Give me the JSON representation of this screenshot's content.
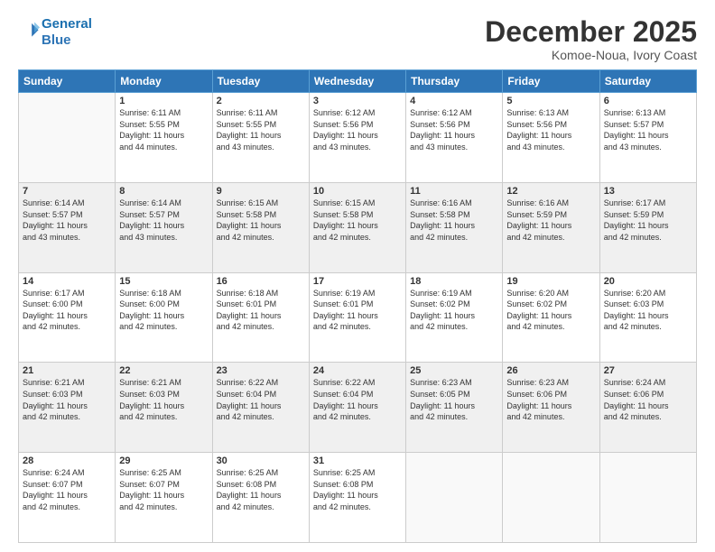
{
  "header": {
    "logo_line1": "General",
    "logo_line2": "Blue",
    "month": "December 2025",
    "location": "Komoe-Noua, Ivory Coast"
  },
  "days_of_week": [
    "Sunday",
    "Monday",
    "Tuesday",
    "Wednesday",
    "Thursday",
    "Friday",
    "Saturday"
  ],
  "weeks": [
    [
      {
        "day": "",
        "info": ""
      },
      {
        "day": "1",
        "info": "Sunrise: 6:11 AM\nSunset: 5:55 PM\nDaylight: 11 hours\nand 44 minutes."
      },
      {
        "day": "2",
        "info": "Sunrise: 6:11 AM\nSunset: 5:55 PM\nDaylight: 11 hours\nand 43 minutes."
      },
      {
        "day": "3",
        "info": "Sunrise: 6:12 AM\nSunset: 5:56 PM\nDaylight: 11 hours\nand 43 minutes."
      },
      {
        "day": "4",
        "info": "Sunrise: 6:12 AM\nSunset: 5:56 PM\nDaylight: 11 hours\nand 43 minutes."
      },
      {
        "day": "5",
        "info": "Sunrise: 6:13 AM\nSunset: 5:56 PM\nDaylight: 11 hours\nand 43 minutes."
      },
      {
        "day": "6",
        "info": "Sunrise: 6:13 AM\nSunset: 5:57 PM\nDaylight: 11 hours\nand 43 minutes."
      }
    ],
    [
      {
        "day": "7",
        "info": "Sunrise: 6:14 AM\nSunset: 5:57 PM\nDaylight: 11 hours\nand 43 minutes."
      },
      {
        "day": "8",
        "info": "Sunrise: 6:14 AM\nSunset: 5:57 PM\nDaylight: 11 hours\nand 43 minutes."
      },
      {
        "day": "9",
        "info": "Sunrise: 6:15 AM\nSunset: 5:58 PM\nDaylight: 11 hours\nand 42 minutes."
      },
      {
        "day": "10",
        "info": "Sunrise: 6:15 AM\nSunset: 5:58 PM\nDaylight: 11 hours\nand 42 minutes."
      },
      {
        "day": "11",
        "info": "Sunrise: 6:16 AM\nSunset: 5:58 PM\nDaylight: 11 hours\nand 42 minutes."
      },
      {
        "day": "12",
        "info": "Sunrise: 6:16 AM\nSunset: 5:59 PM\nDaylight: 11 hours\nand 42 minutes."
      },
      {
        "day": "13",
        "info": "Sunrise: 6:17 AM\nSunset: 5:59 PM\nDaylight: 11 hours\nand 42 minutes."
      }
    ],
    [
      {
        "day": "14",
        "info": "Sunrise: 6:17 AM\nSunset: 6:00 PM\nDaylight: 11 hours\nand 42 minutes."
      },
      {
        "day": "15",
        "info": "Sunrise: 6:18 AM\nSunset: 6:00 PM\nDaylight: 11 hours\nand 42 minutes."
      },
      {
        "day": "16",
        "info": "Sunrise: 6:18 AM\nSunset: 6:01 PM\nDaylight: 11 hours\nand 42 minutes."
      },
      {
        "day": "17",
        "info": "Sunrise: 6:19 AM\nSunset: 6:01 PM\nDaylight: 11 hours\nand 42 minutes."
      },
      {
        "day": "18",
        "info": "Sunrise: 6:19 AM\nSunset: 6:02 PM\nDaylight: 11 hours\nand 42 minutes."
      },
      {
        "day": "19",
        "info": "Sunrise: 6:20 AM\nSunset: 6:02 PM\nDaylight: 11 hours\nand 42 minutes."
      },
      {
        "day": "20",
        "info": "Sunrise: 6:20 AM\nSunset: 6:03 PM\nDaylight: 11 hours\nand 42 minutes."
      }
    ],
    [
      {
        "day": "21",
        "info": "Sunrise: 6:21 AM\nSunset: 6:03 PM\nDaylight: 11 hours\nand 42 minutes."
      },
      {
        "day": "22",
        "info": "Sunrise: 6:21 AM\nSunset: 6:03 PM\nDaylight: 11 hours\nand 42 minutes."
      },
      {
        "day": "23",
        "info": "Sunrise: 6:22 AM\nSunset: 6:04 PM\nDaylight: 11 hours\nand 42 minutes."
      },
      {
        "day": "24",
        "info": "Sunrise: 6:22 AM\nSunset: 6:04 PM\nDaylight: 11 hours\nand 42 minutes."
      },
      {
        "day": "25",
        "info": "Sunrise: 6:23 AM\nSunset: 6:05 PM\nDaylight: 11 hours\nand 42 minutes."
      },
      {
        "day": "26",
        "info": "Sunrise: 6:23 AM\nSunset: 6:06 PM\nDaylight: 11 hours\nand 42 minutes."
      },
      {
        "day": "27",
        "info": "Sunrise: 6:24 AM\nSunset: 6:06 PM\nDaylight: 11 hours\nand 42 minutes."
      }
    ],
    [
      {
        "day": "28",
        "info": "Sunrise: 6:24 AM\nSunset: 6:07 PM\nDaylight: 11 hours\nand 42 minutes."
      },
      {
        "day": "29",
        "info": "Sunrise: 6:25 AM\nSunset: 6:07 PM\nDaylight: 11 hours\nand 42 minutes."
      },
      {
        "day": "30",
        "info": "Sunrise: 6:25 AM\nSunset: 6:08 PM\nDaylight: 11 hours\nand 42 minutes."
      },
      {
        "day": "31",
        "info": "Sunrise: 6:25 AM\nSunset: 6:08 PM\nDaylight: 11 hours\nand 42 minutes."
      },
      {
        "day": "",
        "info": ""
      },
      {
        "day": "",
        "info": ""
      },
      {
        "day": "",
        "info": ""
      }
    ]
  ]
}
